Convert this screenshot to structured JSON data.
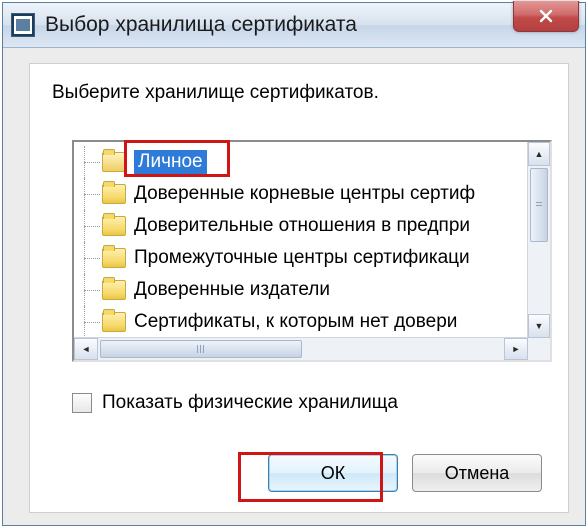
{
  "window": {
    "title": "Выбор хранилища сертификата"
  },
  "instruction": "Выберите хранилище сертификатов.",
  "tree": {
    "items": [
      {
        "label": "Личное"
      },
      {
        "label": "Доверенные корневые центры сертиф"
      },
      {
        "label": "Доверительные отношения в предпри"
      },
      {
        "label": "Промежуточные центры сертификаци"
      },
      {
        "label": "Доверенные издатели"
      },
      {
        "label": "Сертификаты, к которым нет довери"
      }
    ]
  },
  "checkbox": {
    "show_physical": "Показать физические хранилища"
  },
  "buttons": {
    "ok": "ОК",
    "cancel": "Отмена"
  }
}
